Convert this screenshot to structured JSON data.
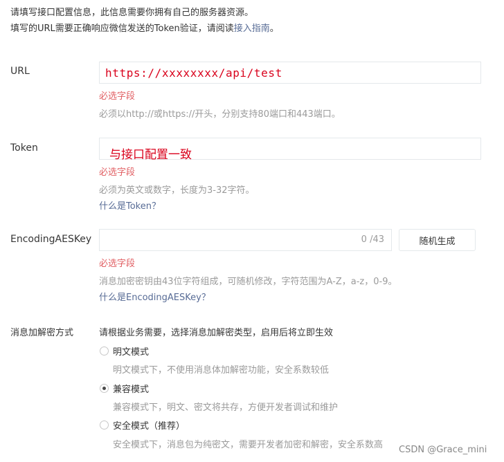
{
  "intro": {
    "line1": "请填写接口配置信息，此信息需要你拥有自己的服务器资源。",
    "line2_prefix": "填写的URL需要正确响应微信发送的Token验证，请阅读",
    "line2_link": "接入指南",
    "line2_suffix": "。"
  },
  "url": {
    "label": "URL",
    "value": "https://xxxxxxxx/api/test",
    "required": "必选字段",
    "hint": "必须以http://或https://开头，分别支持80端口和443端口。"
  },
  "token": {
    "label": "Token",
    "value": "与接口配置一致",
    "required": "必选字段",
    "hint": "必须为英文或数字，长度为3-32字符。",
    "help_link": "什么是Token？"
  },
  "aes": {
    "label": "EncodingAESKey",
    "counter": "0 /43",
    "random_button": "随机生成",
    "required": "必选字段",
    "hint": "消息加密密钥由43位字符组成，可随机修改，字符范围为A-Z，a-z，0-9。",
    "help_link": "什么是EncodingAESKey？"
  },
  "encryption": {
    "label": "消息加解密方式",
    "description": "请根据业务需要，选择消息加解密类型，启用后将立即生效",
    "options": [
      {
        "label": "明文模式",
        "desc": "明文模式下，不使用消息体加解密功能，安全系数较低",
        "checked": false
      },
      {
        "label": "兼容模式",
        "desc": "兼容模式下，明文、密文将共存，方便开发者调试和维护",
        "checked": true
      },
      {
        "label": "安全模式（推荐）",
        "desc": "安全模式下，消息包为纯密文，需要开发者加密和解密，安全系数高",
        "checked": false
      }
    ]
  },
  "watermark": "CSDN @Grace_mini",
  "colors": {
    "link": "#576b95",
    "required": "#e15f63",
    "value_red": "#d9001b",
    "hint": "#9a9a9a"
  }
}
